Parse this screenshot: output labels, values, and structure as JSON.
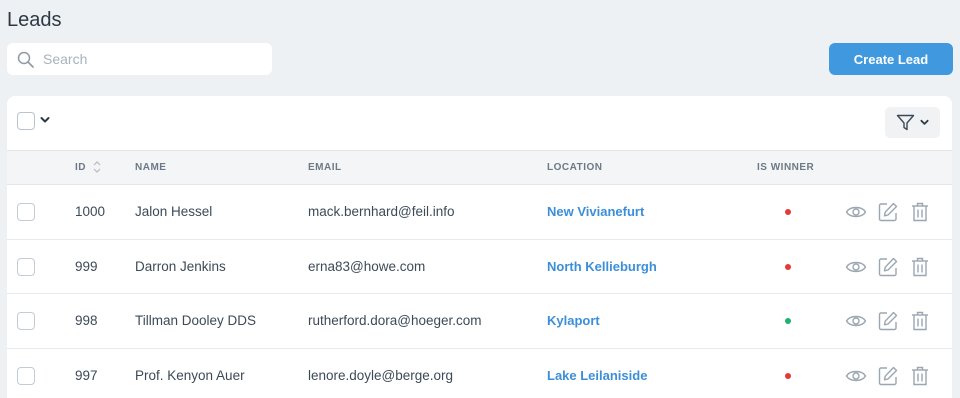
{
  "page": {
    "title": "Leads"
  },
  "search": {
    "placeholder": "Search",
    "value": ""
  },
  "toolbar": {
    "create_label": "Create Lead"
  },
  "table": {
    "headers": {
      "id": "ID",
      "name": "NAME",
      "email": "EMAIL",
      "location": "LOCATION",
      "winner": "IS WINNER"
    },
    "rows": [
      {
        "id": "1000",
        "name": "Jalon Hessel",
        "email": "mack.bernhard@feil.info",
        "location": "New Vivianefurt",
        "is_winner": false
      },
      {
        "id": "999",
        "name": "Darron Jenkins",
        "email": "erna83@howe.com",
        "location": "North Kellieburgh",
        "is_winner": false
      },
      {
        "id": "998",
        "name": "Tillman Dooley DDS",
        "email": "rutherford.dora@hoeger.com",
        "location": "Kylaport",
        "is_winner": true
      },
      {
        "id": "997",
        "name": "Prof. Kenyon Auer",
        "email": "lenore.doyle@berge.org",
        "location": "Lake Leilaniside",
        "is_winner": false
      }
    ]
  },
  "colors": {
    "accent": "#4099de",
    "winner_true": "#21b06e",
    "winner_false": "#e53935",
    "link": "#3b8fd9"
  },
  "icons": [
    "search-icon",
    "chevron-down-icon",
    "filter-icon",
    "sort-icon",
    "eye-icon",
    "edit-icon",
    "trash-icon"
  ]
}
